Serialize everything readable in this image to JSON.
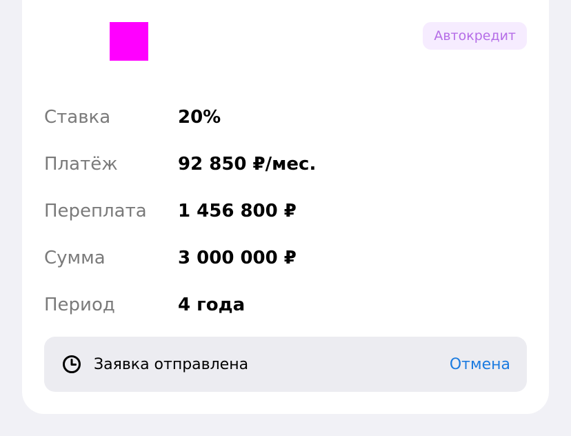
{
  "card": {
    "badge": "Автокредит",
    "logo_color": "#ff00ff",
    "rows": [
      {
        "label": "Ставка",
        "value": "20%"
      },
      {
        "label": "Платёж",
        "value": "92 850 ₽/мес."
      },
      {
        "label": "Переплата",
        "value": "1 456 800 ₽"
      },
      {
        "label": "Сумма",
        "value": "3 000 000 ₽"
      },
      {
        "label": "Период",
        "value": "4 года"
      }
    ],
    "status": {
      "icon": "clock-icon",
      "text": "Заявка отправлена",
      "action": "Отмена"
    }
  },
  "colors": {
    "badge_bg": "#f6ecff",
    "badge_text": "#b56de7",
    "link": "#1b7be0",
    "page_bg": "#f1f1f6"
  }
}
